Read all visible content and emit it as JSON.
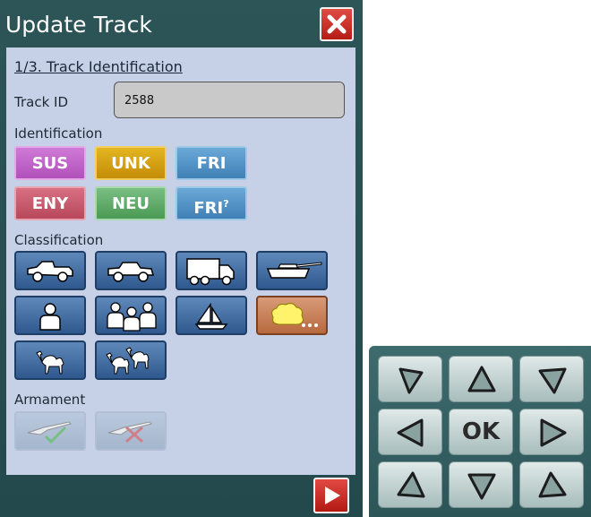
{
  "window": {
    "title": "Update Track"
  },
  "section": {
    "title": "1/3. Track Identification"
  },
  "track": {
    "label": "Track ID",
    "value": "2588"
  },
  "identification": {
    "label": "Identification",
    "buttons": [
      {
        "label": "SUS",
        "color": "#c065c8"
      },
      {
        "label": "UNK",
        "color": "#d9a114"
      },
      {
        "label": "FRI",
        "color": "#5595c8"
      },
      {
        "label": "ENY",
        "color": "#c85b6e"
      },
      {
        "label": "NEU",
        "color": "#62ac6b"
      },
      {
        "label": "FRI",
        "superscript": "?",
        "color": "#5595c8"
      }
    ]
  },
  "classification": {
    "label": "Classification",
    "icons": [
      "jeep-icon",
      "car-icon",
      "truck-icon",
      "tank-icon",
      "person-icon",
      "group-icon",
      "sailboat-icon",
      "other-icon",
      "camel-icon",
      "camels-icon"
    ]
  },
  "armament": {
    "label": "Armament",
    "icons": [
      "armed-rifle-icon",
      "unarmed-rifle-icon"
    ]
  },
  "dpad": {
    "ok_label": "OK"
  }
}
